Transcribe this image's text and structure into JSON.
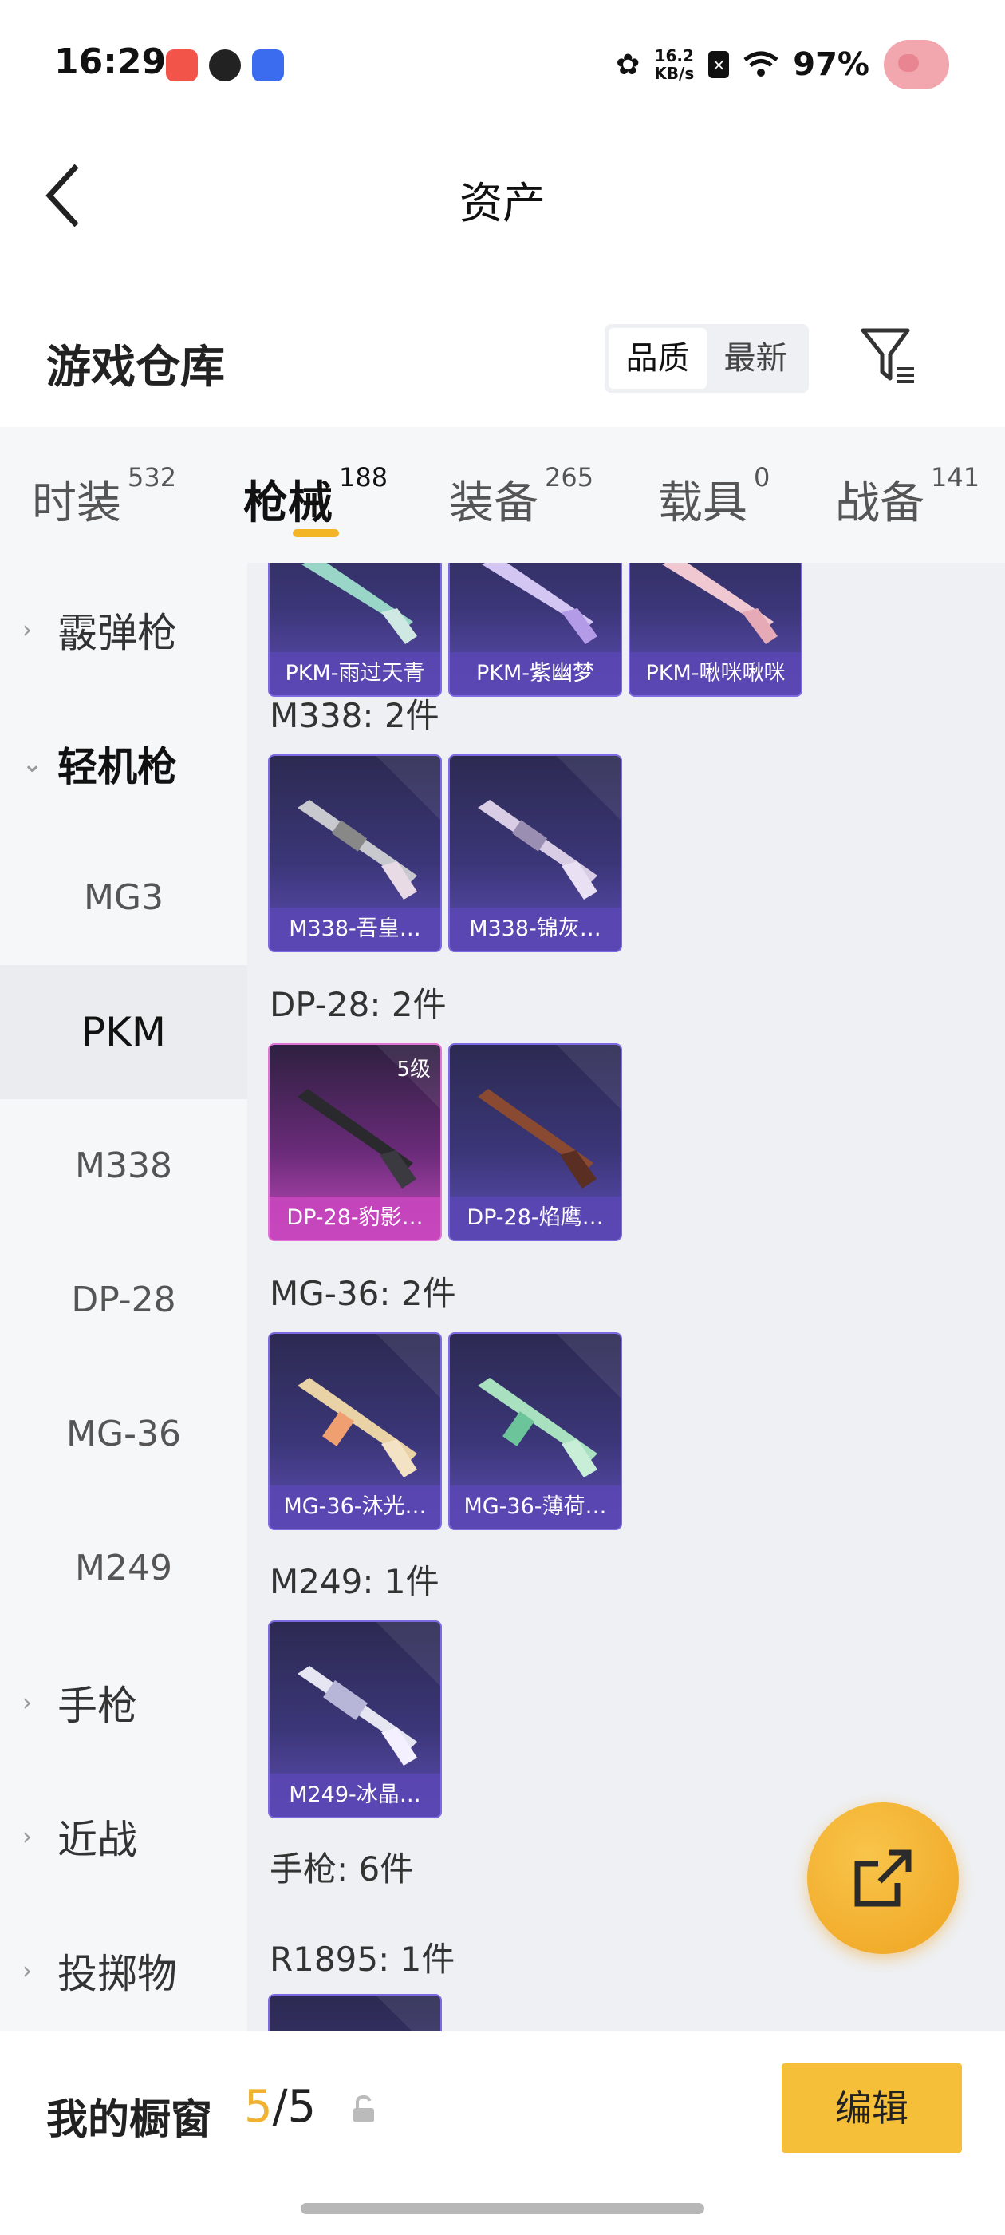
{
  "status": {
    "time": "16:29",
    "net_speed_value": "16.2",
    "net_speed_unit": "KB/s",
    "battery": "97%",
    "app_icon_colors": [
      "#f2544a",
      "#222222",
      "#3b6cf0"
    ]
  },
  "header": {
    "title": "资产",
    "back_icon": "back-arrow-icon"
  },
  "section": {
    "title": "游戏仓库",
    "sort_options": [
      "品质",
      "最新"
    ],
    "sort_selected": "品质",
    "filter_icon": "filter-icon"
  },
  "tabs": [
    {
      "label": "时装",
      "count": "532"
    },
    {
      "label": "枪械",
      "count": "188",
      "active": true
    },
    {
      "label": "装备",
      "count": "265"
    },
    {
      "label": "载具",
      "count": "0"
    },
    {
      "label": "战备",
      "count": "141"
    }
  ],
  "subnav": {
    "shotgun": "霰弹枪",
    "lmg": "轻机枪",
    "lmg_items": [
      "MG3",
      "PKM",
      "M338",
      "DP-28",
      "MG-36",
      "M249"
    ],
    "lmg_selected": "PKM",
    "pistol": "手枪",
    "melee": "近战",
    "throwable": "投掷物"
  },
  "groups": {
    "pkm_cards": [
      "PKM-雨过天青",
      "PKM-紫幽梦",
      "PKM-啾咪啾咪"
    ],
    "m338": {
      "title": "M338: 2件",
      "cards": [
        "M338-吾皇…",
        "M338-锦灰…"
      ]
    },
    "dp28": {
      "title": "DP-28: 2件",
      "cards": [
        "DP-28-豹影…",
        "DP-28-焰鹰…"
      ],
      "level_badge": "5级"
    },
    "mg36": {
      "title": "MG-36: 2件",
      "cards": [
        "MG-36-沐光…",
        "MG-36-薄荷…"
      ]
    },
    "m249": {
      "title": "M249: 1件",
      "cards": [
        "M249-冰晶…"
      ]
    },
    "pistol_title": "手枪: 6件",
    "r1895_title": "R1895: 1件"
  },
  "fab_icon": "share-external-icon",
  "bottom": {
    "showcase_label": "我的橱窗",
    "current": "5",
    "total": "/5",
    "edit": "编辑"
  },
  "colors": {
    "accent": "#f3b526",
    "card_purple": "#5e4eb4",
    "card_pink": "#c24bbb"
  }
}
